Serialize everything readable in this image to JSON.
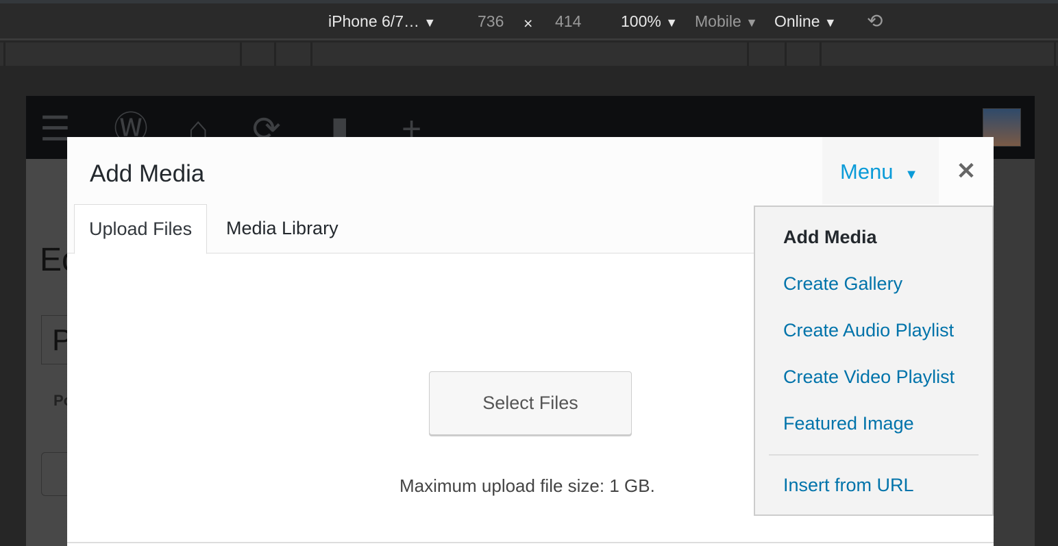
{
  "devtools": {
    "device": "iPhone 6/7…",
    "device_arrow": "▼",
    "width": "736",
    "times": "×",
    "height": "414",
    "zoom": "100%",
    "zoom_arrow": "▼",
    "mode": "Mobile",
    "mode_arrow": "▼",
    "network": "Online",
    "network_arrow": "▼",
    "rotate_icon": "⟲"
  },
  "page": {
    "heading_partial": "Ec",
    "title_partial": "P",
    "label_partial": "Po"
  },
  "modal": {
    "title": "Add Media",
    "menu_label": "Menu",
    "menu_arrow": "▼",
    "close": "✕",
    "tabs": [
      {
        "label": "Upload Files",
        "active": true
      },
      {
        "label": "Media Library",
        "active": false
      }
    ],
    "select_files": "Select Files",
    "max_upload": "Maximum upload file size: 1 GB."
  },
  "dropdown": {
    "items": [
      {
        "label": "Add Media",
        "current": true
      },
      {
        "label": "Create Gallery"
      },
      {
        "label": "Create Audio Playlist"
      },
      {
        "label": "Create Video Playlist"
      },
      {
        "label": "Featured Image"
      },
      {
        "label": "Insert from URL"
      }
    ]
  },
  "colors": {
    "link": "#0073aa",
    "menu_accent": "#0a9bd8"
  }
}
